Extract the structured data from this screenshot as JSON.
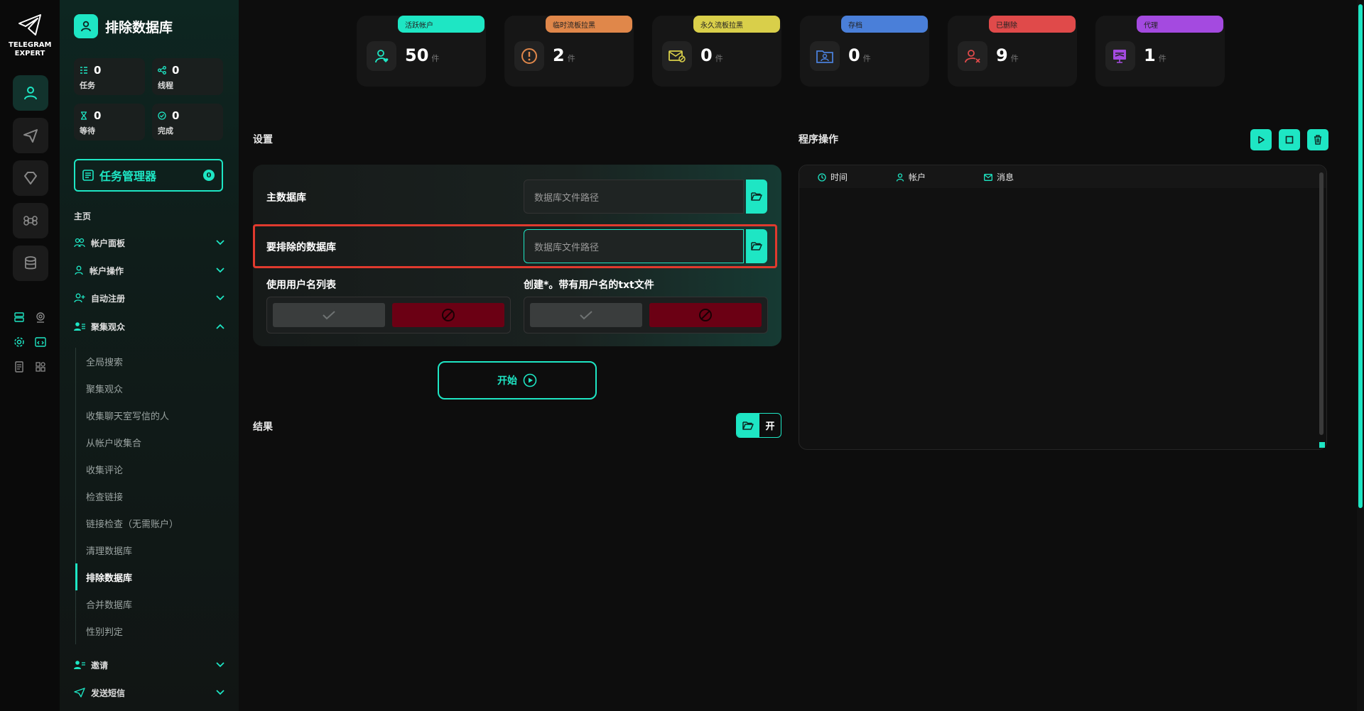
{
  "app": {
    "logo_line1": "TELEGRAM",
    "logo_line2": "EXPERT",
    "accent": "#1ee6c4"
  },
  "sidebar": {
    "title": "排除数据库",
    "stats": [
      {
        "value": "0",
        "label": "任务",
        "icon": "tasks-icon"
      },
      {
        "value": "0",
        "label": "线程",
        "icon": "threads-icon"
      },
      {
        "value": "0",
        "label": "等待",
        "icon": "hourglass-icon"
      },
      {
        "value": "0",
        "label": "完成",
        "icon": "check-circle-icon"
      }
    ],
    "task_manager": {
      "label": "任务管理器",
      "badge": "0"
    },
    "home_label": "主页",
    "groups": [
      {
        "label": "帐户面板"
      },
      {
        "label": "帐户操作"
      },
      {
        "label": "自动注册"
      },
      {
        "label": "聚集观众"
      }
    ],
    "sub_items": [
      "全局搜索",
      "聚集观众",
      "收集聊天室写信的人",
      "从帐户收集合",
      "收集评论",
      "检查链接",
      "链接检查（无需账户）",
      "清理数据库",
      "排除数据库",
      "合并数据库",
      "性别判定"
    ],
    "bottom_groups": [
      {
        "label": "邀请"
      },
      {
        "label": "发送短信"
      }
    ]
  },
  "top_stats": [
    {
      "tag": "活跃帐户",
      "value": "50",
      "unit": "件",
      "color": "#1ee6c4",
      "icon": "user-heart-icon"
    },
    {
      "tag": "临时流板拉黑",
      "value": "2",
      "unit": "件",
      "color": "#e0874a",
      "icon": "warning-circle-icon"
    },
    {
      "tag": "永久流板拉黑",
      "value": "0",
      "unit": "件",
      "color": "#d9cf4a",
      "icon": "mail-block-icon"
    },
    {
      "tag": "存档",
      "value": "0",
      "unit": "件",
      "color": "#4a7fd9",
      "icon": "folder-user-icon"
    },
    {
      "tag": "已删除",
      "value": "9",
      "unit": "件",
      "color": "#e04a4a",
      "icon": "user-x-icon"
    },
    {
      "tag": "代理",
      "value": "1",
      "unit": "件",
      "color": "#a44ae0",
      "icon": "proxy-icon"
    }
  ],
  "settings": {
    "title": "设置",
    "main_db_label": "主数据库",
    "main_db_placeholder": "数据库文件路径",
    "exclude_db_label": "要排除的数据库",
    "exclude_db_placeholder": "数据库文件路径",
    "use_usernames_label": "使用用户名列表",
    "create_txt_label": "创建*。带有用户名的txt文件",
    "start_label": "开始"
  },
  "results": {
    "title": "结果",
    "open_label": "开"
  },
  "ops": {
    "title": "程序操作",
    "columns": [
      {
        "label": "时间",
        "icon": "clock-icon"
      },
      {
        "label": "帐户",
        "icon": "user-icon"
      },
      {
        "label": "消息",
        "icon": "mail-icon"
      }
    ]
  }
}
